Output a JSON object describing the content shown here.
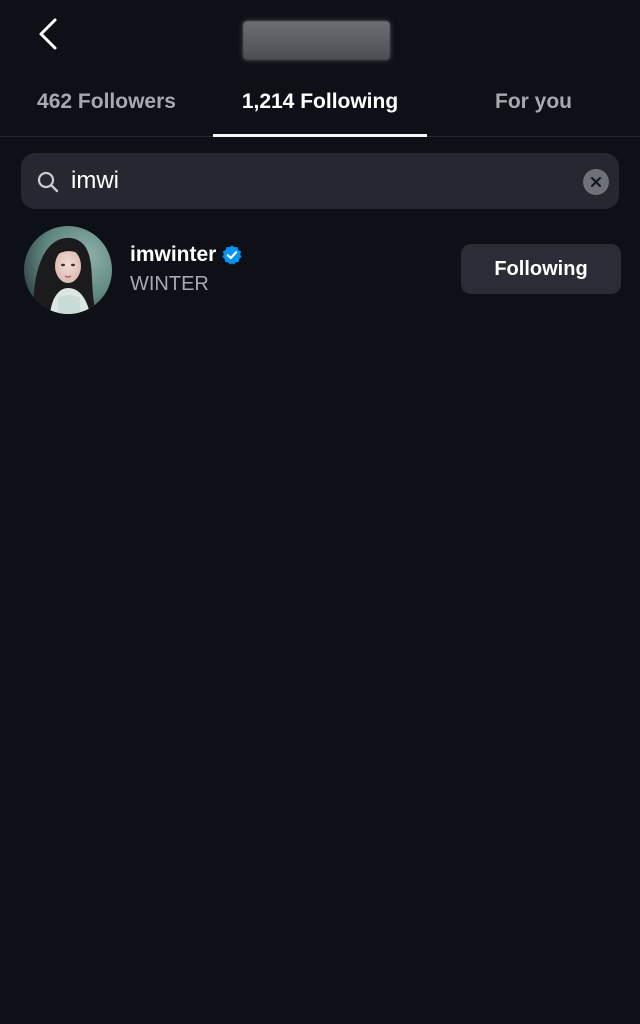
{
  "header": {
    "back_icon": "chevron-left-icon",
    "title_redacted": true
  },
  "tabs": [
    {
      "label": "462 Followers",
      "active": false
    },
    {
      "label": "1,214 Following",
      "active": true
    },
    {
      "label": "For you",
      "active": false
    }
  ],
  "search": {
    "icon": "search-icon",
    "value": "imwi",
    "clear_icon": "clear-icon"
  },
  "results": [
    {
      "username": "imwinter",
      "verified": true,
      "full_name": "WINTER",
      "button_label": "Following"
    }
  ],
  "colors": {
    "background": "#0d1017",
    "surface": "#252830",
    "button": "#2a2d35",
    "text_primary": "#ffffff",
    "text_secondary": "#a7a9ae",
    "verified_blue": "#0095f6"
  }
}
